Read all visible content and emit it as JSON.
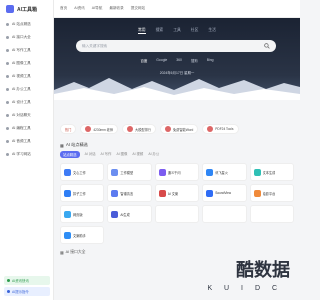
{
  "app": {
    "logo_text": "AI工具箱"
  },
  "sidebar": {
    "items": [
      {
        "label": "AI 站点精选"
      },
      {
        "label": "AI 接口大全"
      },
      {
        "label": "AI 写作工具"
      },
      {
        "label": "AI 图像工具"
      },
      {
        "label": "AI 视频工具"
      },
      {
        "label": "AI 办公工具"
      },
      {
        "label": "AI 设计工具"
      },
      {
        "label": "AI 对话聊天"
      },
      {
        "label": "AI 编程工具"
      },
      {
        "label": "AI 音频工具"
      },
      {
        "label": "AI 学习网站"
      }
    ],
    "bottom_pills": [
      {
        "label": "AI资讯快讯"
      },
      {
        "label": "AI提示指令"
      }
    ]
  },
  "topbar": {
    "items": [
      {
        "label": "首页"
      },
      {
        "label": "AI资讯"
      },
      {
        "label": "AI导航"
      },
      {
        "label": "最新收录"
      },
      {
        "label": "提交网站"
      }
    ]
  },
  "hero": {
    "search_tabs": [
      {
        "label": "常用",
        "active": true
      },
      {
        "label": "搜索",
        "active": false
      },
      {
        "label": "工具",
        "active": false
      },
      {
        "label": "社区",
        "active": false
      },
      {
        "label": "生活",
        "active": false
      }
    ],
    "search_placeholder": "输入关键字搜索",
    "engines": [
      {
        "label": "百度",
        "active": true
      },
      {
        "label": "Google",
        "active": false
      },
      {
        "label": "360",
        "active": false
      },
      {
        "label": "搜狗",
        "active": false
      },
      {
        "label": "Bing",
        "active": false
      }
    ],
    "note": "2024年6月17日 星期一"
  },
  "hot": {
    "chips": [
      {
        "label": "热门"
      },
      {
        "label": "4230mm 老师"
      },
      {
        "label": "大模型排行"
      },
      {
        "label": "免费智能Word"
      },
      {
        "label": "PDF24 Tools"
      }
    ]
  },
  "section": {
    "title": "AI 站点精选",
    "tabs": [
      {
        "label": "站点精选",
        "active": true
      },
      {
        "label": "AI 对话"
      },
      {
        "label": "AI 写作"
      },
      {
        "label": "AI 图像"
      },
      {
        "label": "AI 视频"
      },
      {
        "label": "AI 办公"
      }
    ],
    "cards": [
      {
        "label": "文心工作",
        "color": "#3f7cf5"
      },
      {
        "label": "工作模型",
        "color": "#6b8ef0"
      },
      {
        "label": "通义千问",
        "color": "#7c5cf0"
      },
      {
        "label": "讯飞星火",
        "color": "#2f86f5"
      },
      {
        "label": "文本生成",
        "color": "#2fc0b5"
      },
      {
        "label": "扣子工作",
        "color": "#2f7ef5"
      },
      {
        "label": "智谱清言",
        "color": "#5c7bf0"
      },
      {
        "label": "AI 文案",
        "color": "#d84a4a"
      },
      {
        "label": "SoundView",
        "color": "#2f6cf5"
      },
      {
        "label": "绘影平台",
        "color": "#f08a3a"
      },
      {
        "label": "网页版",
        "color": "#3aa8f0"
      },
      {
        "label": "AI生成",
        "color": "#4a5cd8"
      },
      {
        "label": "",
        "color": "#ffffff"
      },
      {
        "label": "",
        "color": "#ffffff"
      },
      {
        "label": "",
        "color": "#ffffff"
      },
      {
        "label": "文案助手",
        "color": "#2f8ef5"
      }
    ],
    "footer_title": "AI 接口大全"
  },
  "watermark": {
    "main": "酷数据",
    "sub": "K U I D C"
  }
}
